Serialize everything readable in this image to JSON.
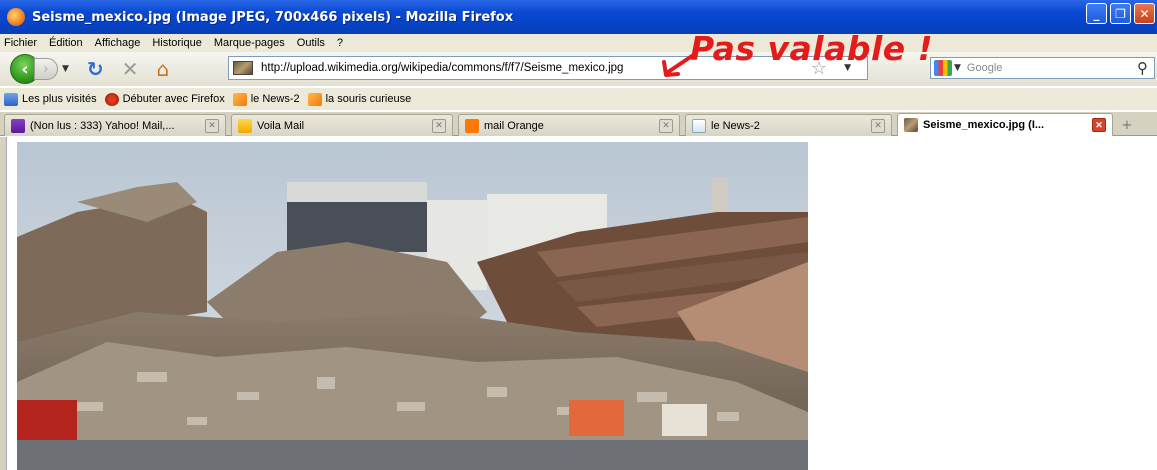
{
  "window": {
    "title": "Seisme_mexico.jpg (Image JPEG, 700x466 pixels) - Mozilla Firefox",
    "buttons": {
      "minimize": "_",
      "maximize": "❐",
      "close": "✕"
    }
  },
  "menu": [
    "Fichier",
    "Édition",
    "Affichage",
    "Historique",
    "Marque-pages",
    "Outils",
    "?"
  ],
  "toolbar": {
    "url": "http://upload.wikimedia.org/wikipedia/commons/f/f7/Seisme_mexico.jpg",
    "search_placeholder": "Google"
  },
  "annotation": {
    "text": "Pas valable !",
    "color": "#e41b1b"
  },
  "bookmarks": [
    {
      "label": "Les plus visités",
      "icon": "folder-icon"
    },
    {
      "label": "Débuter avec Firefox",
      "icon": "firefox-icon"
    },
    {
      "label": "le News-2",
      "icon": "rss-icon"
    },
    {
      "label": "la souris curieuse",
      "icon": "rss-icon"
    }
  ],
  "tabs": [
    {
      "label": "(Non lus : 333) Yahoo! Mail,...",
      "active": false
    },
    {
      "label": "Voila Mail",
      "active": false
    },
    {
      "label": "mail Orange",
      "active": false
    },
    {
      "label": "le News-2",
      "active": false
    },
    {
      "label": "Seisme_mexico.jpg (I...",
      "active": true
    }
  ],
  "content": {
    "image": "collapsed-building-rubble-photo"
  }
}
